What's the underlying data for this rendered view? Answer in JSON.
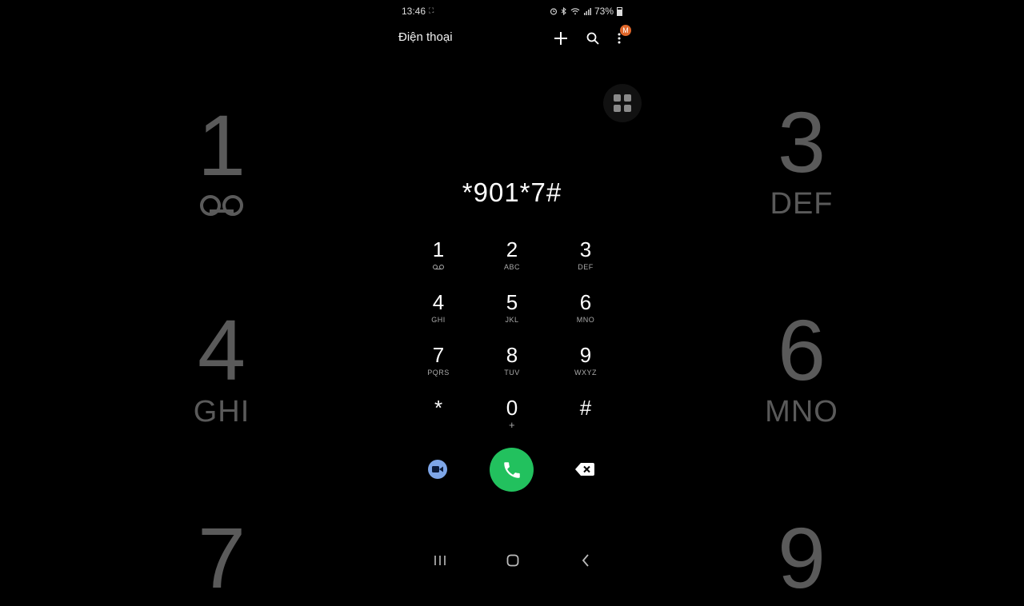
{
  "status_bar": {
    "time": "13:46",
    "time_extra": "⛶",
    "battery": "73%"
  },
  "app_bar": {
    "title": "Điện thoại",
    "badge": "M"
  },
  "dialed_number": "*901*7#",
  "keys": [
    {
      "digit": "1",
      "letters": ""
    },
    {
      "digit": "2",
      "letters": "ABC"
    },
    {
      "digit": "3",
      "letters": "DEF"
    },
    {
      "digit": "4",
      "letters": "GHI"
    },
    {
      "digit": "5",
      "letters": "JKL"
    },
    {
      "digit": "6",
      "letters": "MNO"
    },
    {
      "digit": "7",
      "letters": "PQRS"
    },
    {
      "digit": "8",
      "letters": "TUV"
    },
    {
      "digit": "9",
      "letters": "WXYZ"
    },
    {
      "digit": "*",
      "letters": ""
    },
    {
      "digit": "0",
      "letters": "+"
    },
    {
      "digit": "#",
      "letters": ""
    }
  ],
  "background_keys": {
    "left": [
      {
        "digit": "1",
        "letters": ""
      },
      {
        "digit": "4",
        "letters": "GHI"
      },
      {
        "digit": "7",
        "letters": ""
      }
    ],
    "right": [
      {
        "digit": "3",
        "letters": "DEF"
      },
      {
        "digit": "6",
        "letters": "MNO"
      },
      {
        "digit": "9",
        "letters": ""
      }
    ]
  },
  "colors": {
    "call": "#22c15e",
    "video": "#7ea6e8",
    "badge": "#e0672a"
  }
}
